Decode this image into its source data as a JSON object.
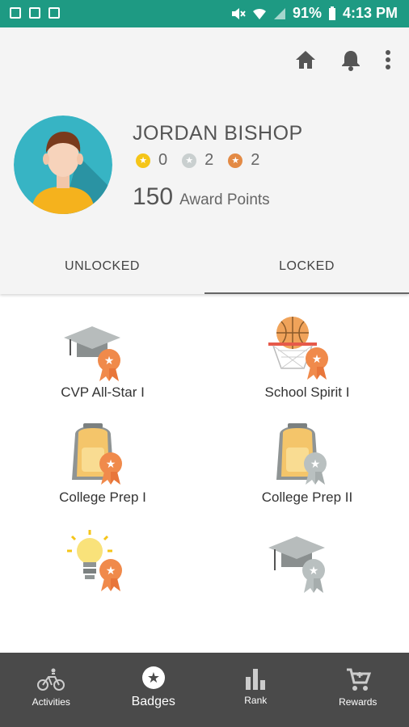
{
  "status_bar": {
    "battery": "91%",
    "time": "4:13 PM"
  },
  "profile": {
    "name": "JORDAN BISHOP",
    "gold_count": "0",
    "silver_count": "2",
    "bronze_count": "2",
    "points": "150",
    "points_label": "Award Points"
  },
  "tabs": [
    {
      "label": "UNLOCKED"
    },
    {
      "label": "LOCKED"
    }
  ],
  "badges": [
    {
      "label": "CVP All-Star I"
    },
    {
      "label": "School Spirit I"
    },
    {
      "label": "College Prep I"
    },
    {
      "label": "College Prep II"
    },
    {
      "label": ""
    },
    {
      "label": ""
    }
  ],
  "bottom_nav": [
    {
      "label": "Activities"
    },
    {
      "label": "Badges"
    },
    {
      "label": "Rank"
    },
    {
      "label": "Rewards"
    }
  ],
  "colors": {
    "status_bar": "#1e9a83",
    "bronze": "#f08a4b",
    "silver": "#b9c0c0",
    "gold": "#f5c518",
    "nav_bg": "#4a4a4a"
  }
}
